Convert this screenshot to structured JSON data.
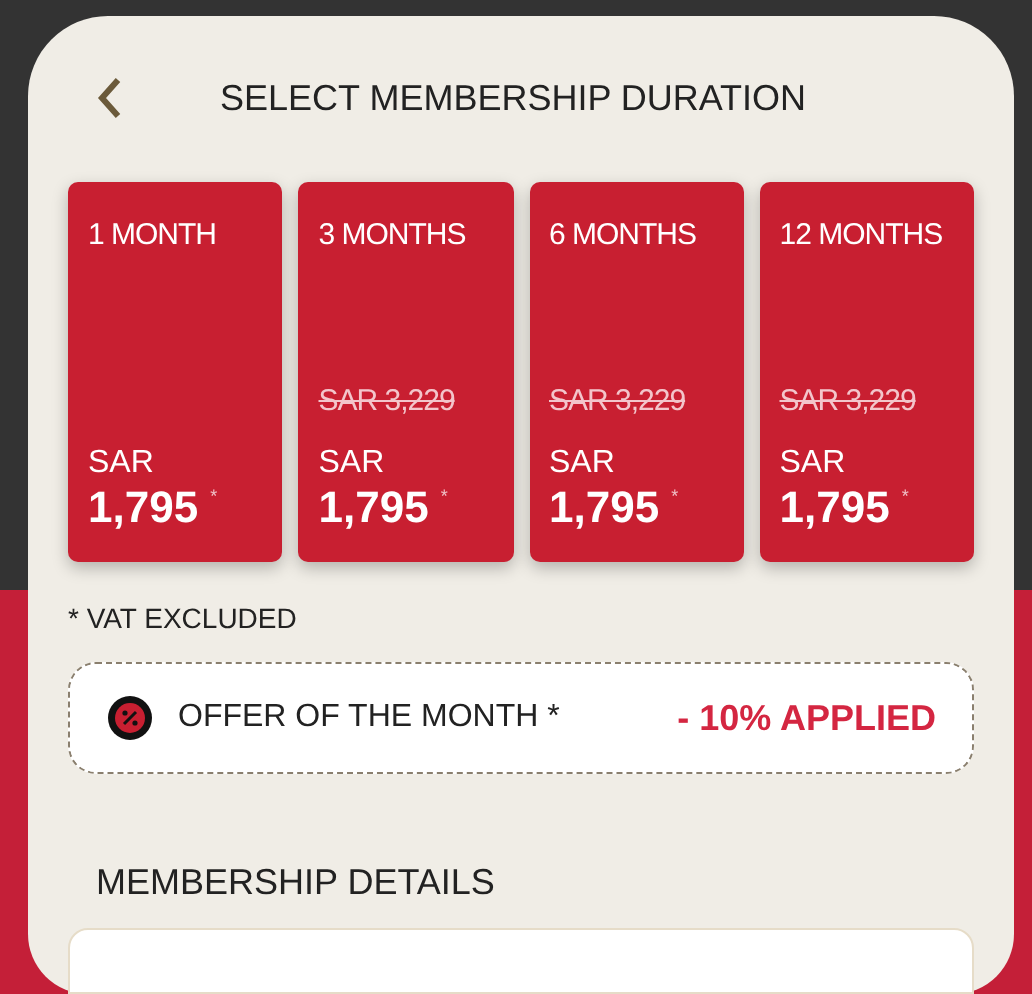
{
  "header": {
    "title": "SELECT MEMBERSHIP DURATION"
  },
  "plans": [
    {
      "duration": "1 MONTH",
      "currency": "SAR",
      "price": "1,795",
      "mark": "*"
    },
    {
      "duration": "3 MONTHS",
      "old_price": "SAR 3,229",
      "currency": "SAR",
      "price": "1,795",
      "mark": "*"
    },
    {
      "duration": "6 MONTHS",
      "old_price": "SAR 3,229",
      "currency": "SAR",
      "price": "1,795",
      "mark": "*"
    },
    {
      "duration": "12 MONTHS",
      "old_price": "SAR 3,229",
      "currency": "SAR",
      "price": "1,795",
      "mark": "*"
    }
  ],
  "vat_note": "* VAT EXCLUDED",
  "offer": {
    "label": "OFFER OF THE MONTH *",
    "value": "- 10% APPLIED"
  },
  "details": {
    "title": "MEMBERSHIP DETAILS"
  }
}
